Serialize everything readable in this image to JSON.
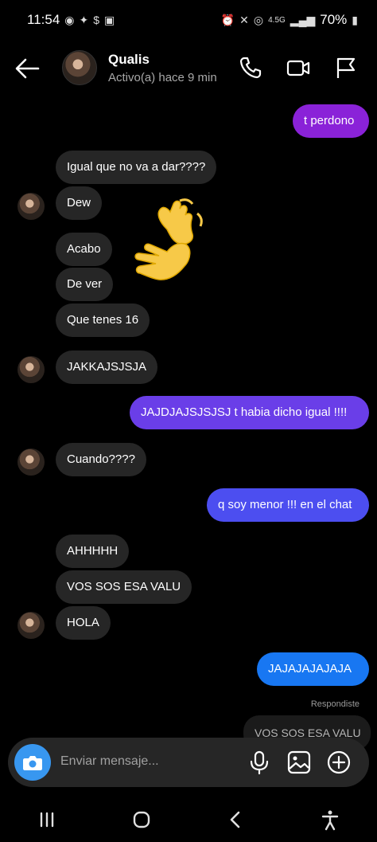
{
  "status_bar": {
    "time": "11:54",
    "battery": "70%",
    "network": "4.5G"
  },
  "header": {
    "name": "Qualis",
    "status": "Activo(a) hace 9 min"
  },
  "messages": {
    "m1": "t perdono",
    "m2": "Igual que no va a dar????",
    "m3": "Dew",
    "m4": "Acabo",
    "m5": "De ver",
    "m6": "Que tenes 16",
    "m7": "JAKKAJSJSJA",
    "m8": "JAJDJAJSJSJSJ t habia dicho igual !!!!",
    "m9": "Cuando????",
    "m10": "q soy menor !!! en el chat",
    "m11": "AHHHHH",
    "m12": "VOS SOS ESA VALU",
    "m13": "HOLA",
    "m14": "JAJAJAJAJAJA"
  },
  "reply": {
    "label": "Respondiste",
    "quote": "VOS SOS ESA VALU"
  },
  "composer": {
    "placeholder": "Enviar mensaje..."
  },
  "colors": {
    "purple": "#8a22d8",
    "violet": "#6a3ee8",
    "indigo": "#4c4ef0",
    "blue": "#1877f2",
    "incoming": "#262626"
  }
}
